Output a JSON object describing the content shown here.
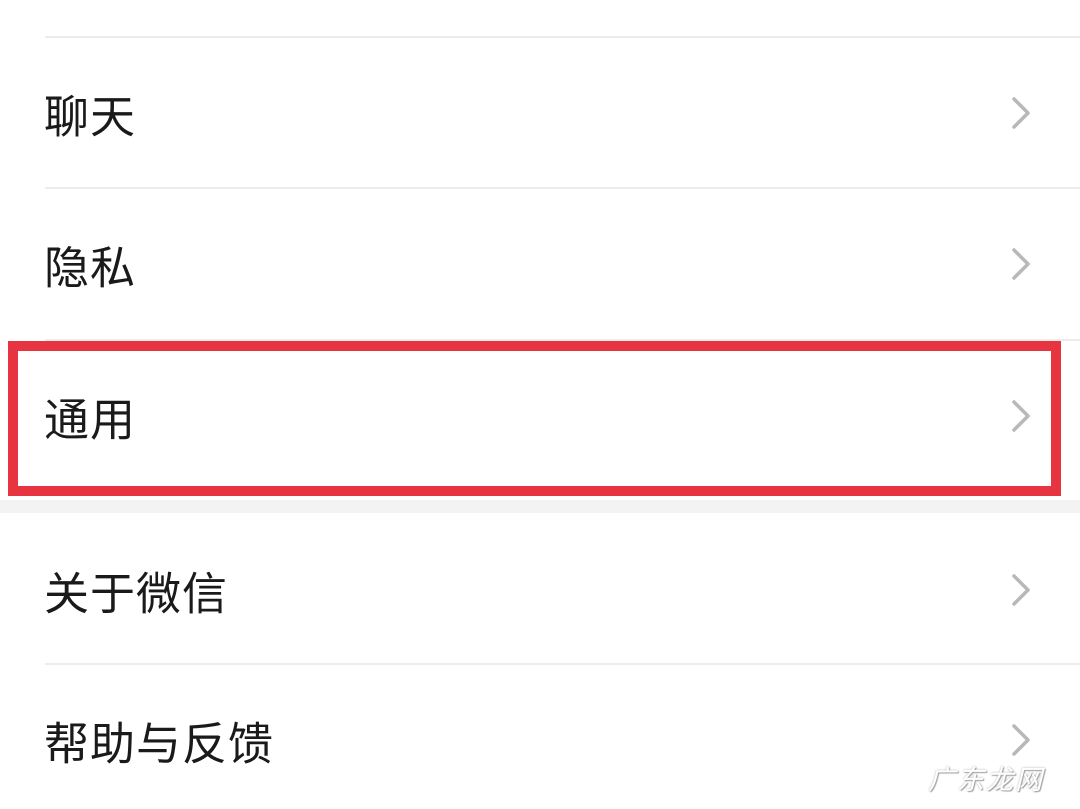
{
  "colors": {
    "background": "#f3f3f3",
    "row_background": "#ffffff",
    "text": "#1a1a1a",
    "chevron": "#b8b8b8",
    "divider": "#ececec",
    "highlight": "#e63440"
  },
  "settings": {
    "items": [
      {
        "label": "聊天",
        "icon": "chevron-right-icon"
      },
      {
        "label": "隐私",
        "icon": "chevron-right-icon"
      },
      {
        "label": "通用",
        "icon": "chevron-right-icon",
        "highlighted": true
      },
      {
        "label": "关于微信",
        "icon": "chevron-right-icon"
      },
      {
        "label": "帮助与反馈",
        "icon": "chevron-right-icon"
      }
    ]
  },
  "watermark": {
    "text": "广东龙网"
  }
}
